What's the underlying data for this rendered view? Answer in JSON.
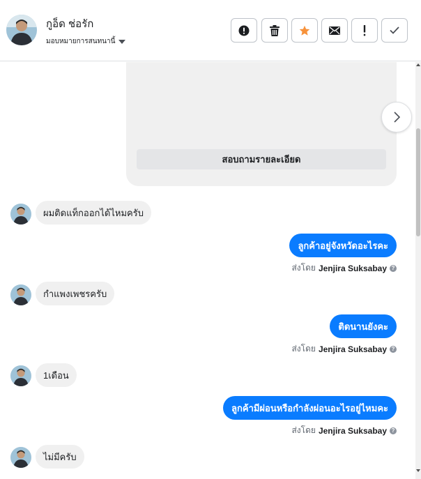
{
  "header": {
    "contact_name": "กูอ็ด ช่อรัก",
    "assign_label": "มอบหมายการสนทนานี้",
    "actions": [
      {
        "name": "spam-button",
        "icon": "exclamation-circle-icon"
      },
      {
        "name": "delete-button",
        "icon": "trash-icon"
      },
      {
        "name": "star-button",
        "icon": "star-icon",
        "color": "#f7923b"
      },
      {
        "name": "mark-unread-button",
        "icon": "envelope-icon"
      },
      {
        "name": "follow-up-button",
        "icon": "exclamation-icon"
      },
      {
        "name": "mark-done-button",
        "icon": "checkmark-icon"
      }
    ]
  },
  "card": {
    "button_label": "สอบถามรายละเอียด"
  },
  "messages": [
    {
      "direction": "in",
      "text": "ผมติดแท็กออกได้ไหมครับ"
    },
    {
      "direction": "out",
      "text": "ลูกค้าอยู่จังหวัดอะไรคะ",
      "sent_by_label": "ส่งโดย",
      "sender": "Jenjira Suksabay"
    },
    {
      "direction": "in",
      "text": "กำแพงเพชรครับ"
    },
    {
      "direction": "out",
      "text": "ติดนานยังคะ",
      "sent_by_label": "ส่งโดย",
      "sender": "Jenjira Suksabay"
    },
    {
      "direction": "in",
      "text": "1เดือน"
    },
    {
      "direction": "out",
      "text": "ลูกค้ามีผ่อนหรือกำลังผ่อนอะไรอยู่ไหมคะ",
      "sent_by_label": "ส่งโดย",
      "sender": "Jenjira Suksabay"
    },
    {
      "direction": "in",
      "text": "ไม่มีครับ"
    }
  ],
  "colors": {
    "outgoing_bubble": "#0a7cff",
    "incoming_bubble": "#f0f0f0",
    "star": "#f7923b"
  }
}
